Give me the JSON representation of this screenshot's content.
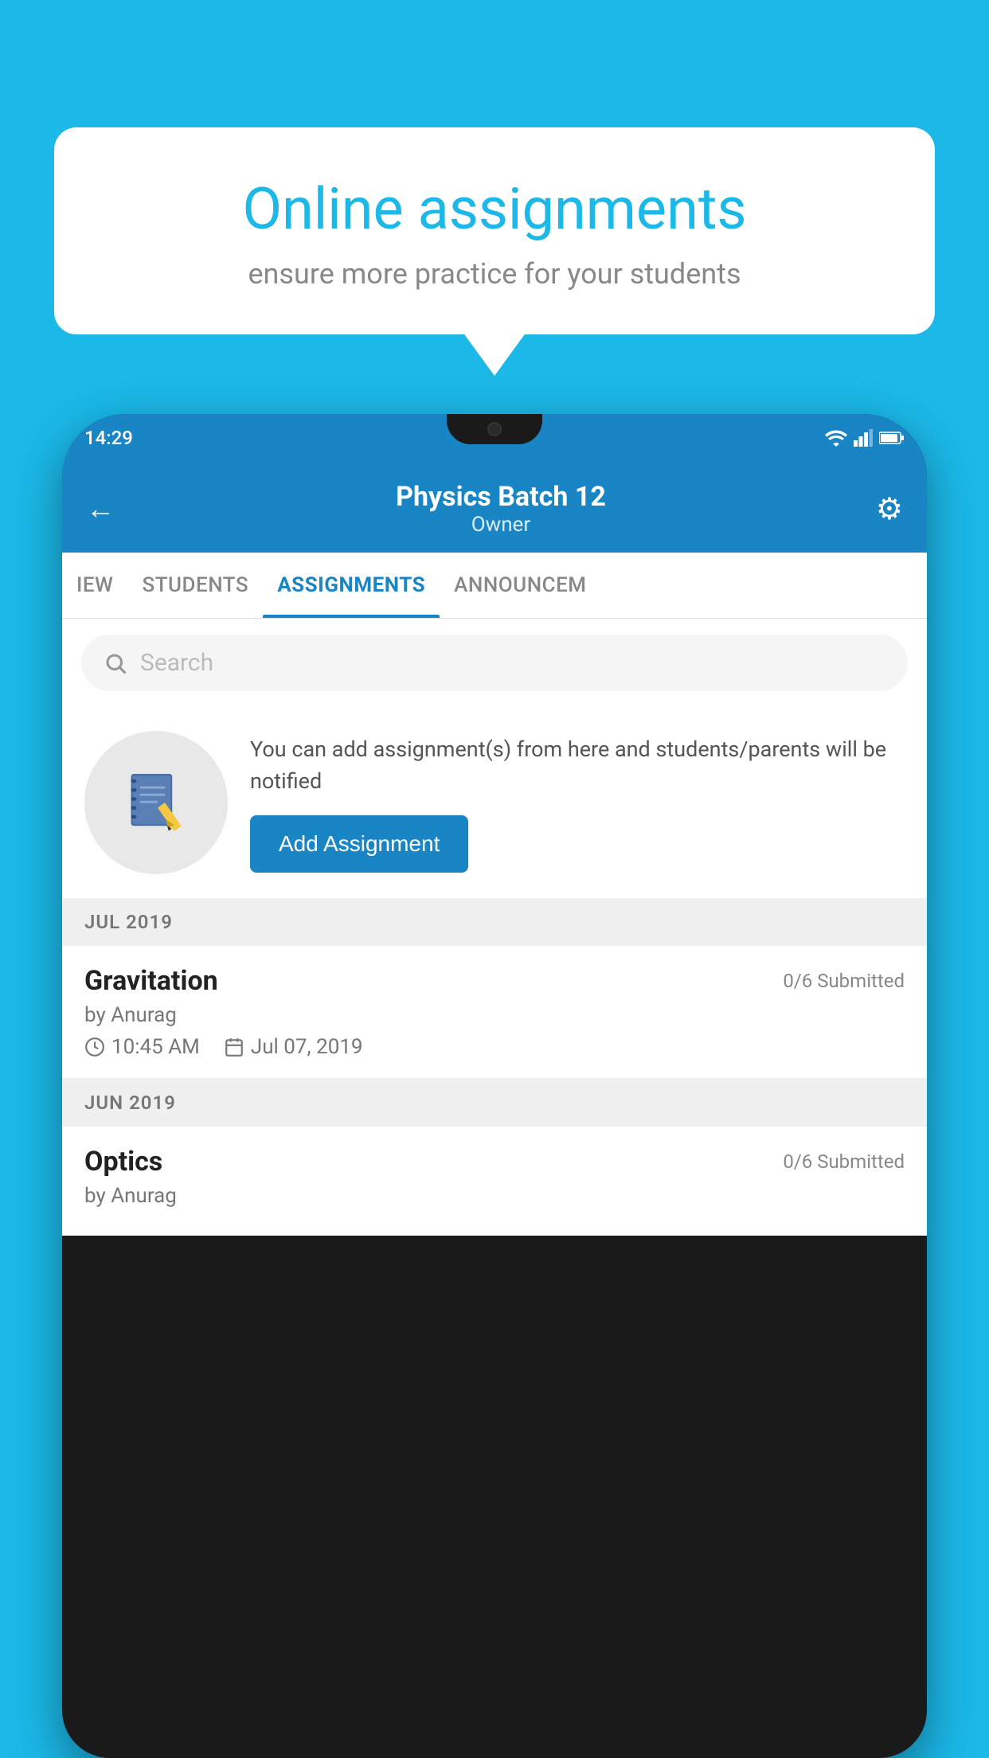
{
  "background_color": "#1BB8E8",
  "speech_bubble": {
    "title": "Online assignments",
    "subtitle": "ensure more practice for your students"
  },
  "phone": {
    "status_bar": {
      "time": "14:29",
      "icons": [
        "wifi",
        "signal",
        "battery"
      ]
    },
    "app_bar": {
      "title": "Physics Batch 12",
      "subtitle": "Owner",
      "back_label": "←",
      "settings_label": "⚙"
    },
    "tabs": [
      {
        "label": "IEW",
        "active": false
      },
      {
        "label": "STUDENTS",
        "active": false
      },
      {
        "label": "ASSIGNMENTS",
        "active": true
      },
      {
        "label": "ANNOUNCEM",
        "active": false
      }
    ],
    "search": {
      "placeholder": "Search"
    },
    "promo": {
      "text": "You can add assignment(s) from here and students/parents will be notified",
      "button_label": "Add Assignment"
    },
    "sections": [
      {
        "header": "JUL 2019",
        "assignments": [
          {
            "name": "Gravitation",
            "submitted": "0/6 Submitted",
            "by": "by Anurag",
            "time": "10:45 AM",
            "date": "Jul 07, 2019"
          }
        ]
      },
      {
        "header": "JUN 2019",
        "assignments": [
          {
            "name": "Optics",
            "submitted": "0/6 Submitted",
            "by": "by Anurag",
            "time": "",
            "date": ""
          }
        ]
      }
    ]
  }
}
